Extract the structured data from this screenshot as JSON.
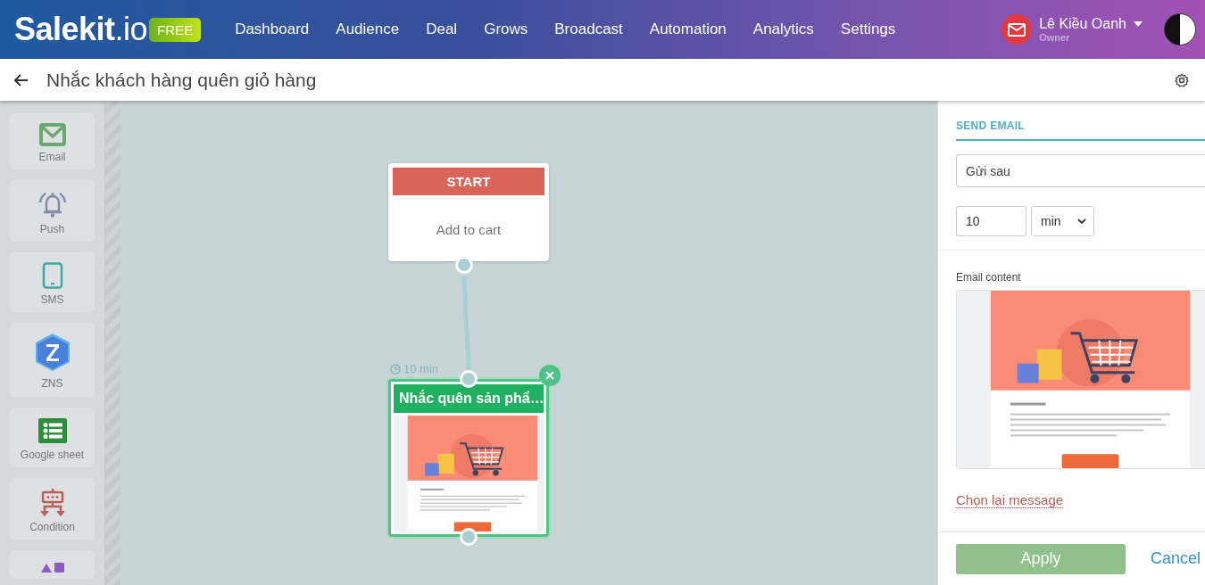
{
  "header": {
    "logo": "**Salekit**.io",
    "plan_badge": "FREE",
    "nav": [
      {
        "label": "Dashboard"
      },
      {
        "label": "Audience"
      },
      {
        "label": "Deal"
      },
      {
        "label": "Grows"
      },
      {
        "label": "Broadcast"
      },
      {
        "label": "Automation"
      },
      {
        "label": "Analytics"
      },
      {
        "label": "Settings"
      }
    ],
    "user": {
      "name": "Lê Kiều Oanh",
      "role": "Owner"
    }
  },
  "page": {
    "title": "Nhắc khách hàng quên giỏ hàng"
  },
  "toolbox": {
    "items": [
      {
        "kind": "email",
        "label": "Email"
      },
      {
        "kind": "push",
        "label": "Push"
      },
      {
        "kind": "sms",
        "label": "SMS"
      },
      {
        "kind": "zns",
        "label": "ZNS"
      },
      {
        "kind": "sheet",
        "label": "Google sheet"
      },
      {
        "kind": "condition",
        "label": "Condition"
      },
      {
        "kind": "more"
      }
    ]
  },
  "flow": {
    "nodes": [
      {
        "kind": "trigger",
        "title": "START",
        "label": "Add to cart",
        "selected": false
      },
      {
        "kind": "email",
        "delay": "10 min",
        "title": "Nhắc quên sản phẩ…",
        "selected": true
      }
    ]
  },
  "panel": {
    "tab": "SEND EMAIL",
    "timing": "Gửi sau",
    "delay_value": "10",
    "delay_unit": "min",
    "content_label": "Email content",
    "reselect_link": "Chọn lại message",
    "apply": "Apply",
    "cancel": "Cancel"
  }
}
